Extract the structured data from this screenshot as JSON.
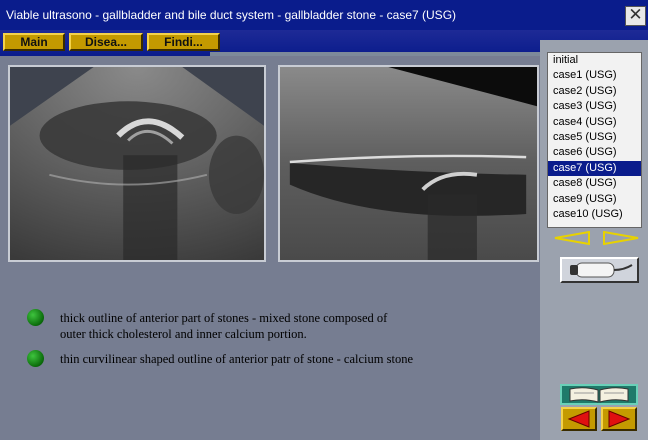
{
  "window": {
    "title": "Viable ultrasono - gallbladder and bile duct system - gallbladder stone - case7 (USG)",
    "close_glyph": "✕"
  },
  "menu": {
    "items": [
      {
        "label": "Main"
      },
      {
        "label": "Disea..."
      },
      {
        "label": "Findi..."
      }
    ]
  },
  "findings": [
    {
      "line1": "thick outline of anterior part of stones - mixed stone composed of",
      "line2": "outer thick cholesterol and inner calcium portion."
    },
    {
      "line1": "thin curvilinear shaped outline of anterior patr of stone - calcium stone"
    }
  ],
  "case_list": {
    "items": [
      "initial",
      "case1 (USG)",
      "case2 (USG)",
      "case3 (USG)",
      "case4 (USG)",
      "case5 (USG)",
      "case6 (USG)",
      "case7 (USG)",
      "case8 (USG)",
      "case9 (USG)",
      "case10 (USG)"
    ],
    "selected": "case7 (USG)"
  },
  "icons": {
    "close": "close-icon",
    "prev_case": "arrow-left-outline-icon",
    "next_case": "arrow-right-outline-icon",
    "probe": "ultrasound-probe-icon",
    "book": "open-book-icon",
    "prev_page": "arrow-left-icon",
    "next_page": "arrow-right-icon"
  },
  "colors": {
    "title_bar": "#0a1c8c",
    "menu_button": "#c49a00",
    "selection": "#0a1c8c",
    "content_bg": "#767d91",
    "sidebar_bg": "#9ba2ae",
    "bullet": "#1a8a1a",
    "nav_arrow": "#e8d200"
  }
}
